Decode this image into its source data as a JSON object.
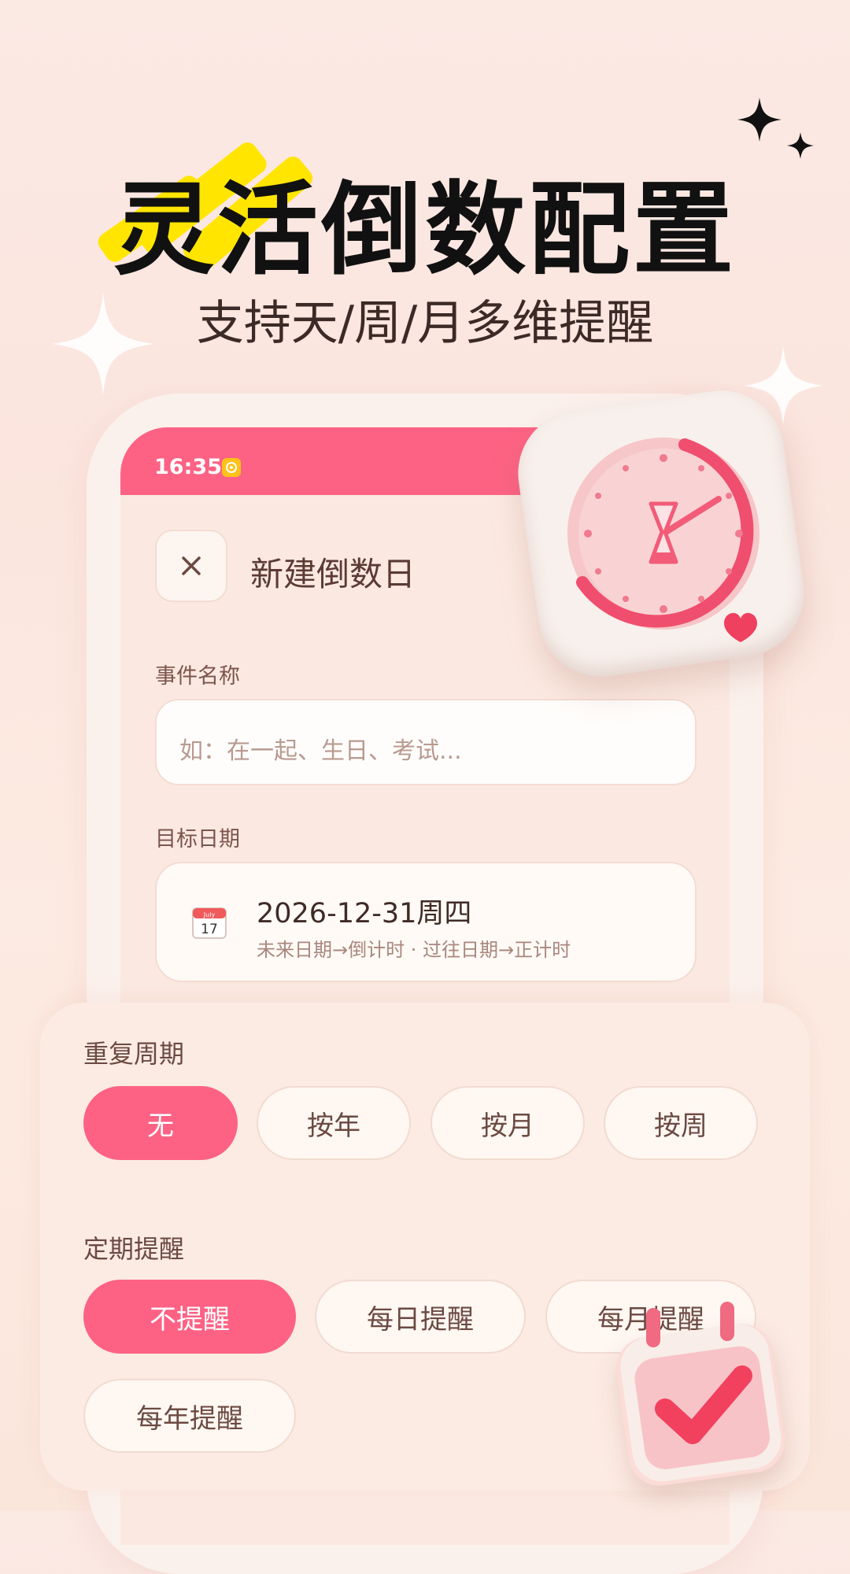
{
  "headline": "灵活倒数配置",
  "subheadline": "支持天/周/月多维提醒",
  "status_bar": {
    "time": "16:35"
  },
  "header": {
    "close_icon": "close-icon",
    "title": "新建倒数日"
  },
  "event_name": {
    "label": "事件名称",
    "placeholder": "如：在一起、生日、考试..."
  },
  "target_date": {
    "label": "目标日期",
    "calendar_icon_month": "July",
    "calendar_icon_day": "17",
    "value": "2026-12-31周四",
    "hint": "未来日期→倒计时 · 过往日期→正计时"
  },
  "repeat": {
    "label": "重复周期",
    "options": [
      "无",
      "按年",
      "按月",
      "按周"
    ],
    "selected": "无"
  },
  "reminder": {
    "label": "定期提醒",
    "options": [
      "不提醒",
      "每日提醒",
      "每月提醒",
      "每年提醒"
    ],
    "selected": "不提醒"
  },
  "colors": {
    "accent": "#fd6284",
    "highlight": "#ffe500",
    "background": "#fbe9e4"
  }
}
